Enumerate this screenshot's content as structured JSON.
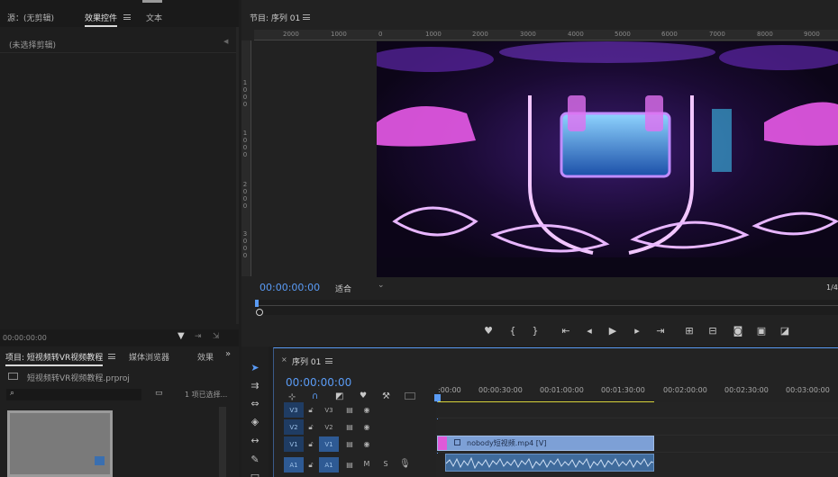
{
  "source_panel": {
    "tab_source": "源：(无剪辑)",
    "tab_effects": "效果控件",
    "tab_text": "文本",
    "no_clip": "(未选择剪辑)",
    "timecode": "00:00:00:00"
  },
  "program_monitor": {
    "title": "节目: 序列 01",
    "ruler_labels": [
      "2000",
      "1000",
      "0",
      "1000",
      "2000",
      "3000",
      "4000",
      "5000",
      "6000",
      "7000",
      "8000",
      "9000"
    ],
    "vruler_top": [
      "1",
      "0",
      "0",
      "0"
    ],
    "vruler_mid": [
      "1",
      "0",
      "0",
      "0"
    ],
    "vruler_bot": [
      "2",
      "0",
      "0",
      "0"
    ],
    "vruler_low": [
      "3",
      "0",
      "0",
      "0"
    ],
    "timecode": "00:00:00:00",
    "fit_label": "适合",
    "resolution": "1/4"
  },
  "project_panel": {
    "tab_project": "项目: 短视频转VR视频教程",
    "tab_media": "媒体浏览器",
    "tab_effects": "效果",
    "file_name": "短视频转VR视频教程.prproj",
    "selection": "1 项已选择..."
  },
  "timeline": {
    "tab": "序列 01",
    "timecode": "00:00:00:00",
    "time_labels": [
      ":00:00",
      "00:00:30:00",
      "00:01:00:00",
      "00:01:30:00",
      "00:02:00:00",
      "00:02:30:00",
      "00:03:00:00"
    ],
    "tracks": [
      {
        "id": "V3",
        "src": "V3"
      },
      {
        "id": "V2",
        "src": "V2"
      },
      {
        "id": "V1",
        "src": "V1"
      },
      {
        "id": "A1",
        "src": "A1"
      }
    ],
    "mute_label": "M",
    "solo_label": "S",
    "clip_name": "nobody短视频.mp4 [V]",
    "accent_color": "#5a9bf5",
    "clip_color": "#7da0d6"
  },
  "icons": [
    "menu-icon",
    "filter-icon",
    "play-icon",
    "marker-icon",
    "camera-icon",
    "wrench-icon",
    "magnet-icon",
    "eye-icon",
    "lock-icon",
    "selection-tool-icon",
    "razor-icon",
    "pen-icon"
  ]
}
